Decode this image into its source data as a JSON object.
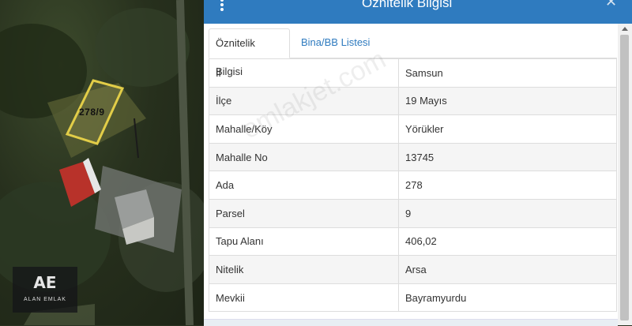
{
  "map": {
    "parcel_label": "278/9",
    "logo_mark": "AE",
    "logo_text": "ALAN EMLAK"
  },
  "modal": {
    "title": "Öznitelik Bilgisi",
    "tabs": [
      {
        "label": "Öznitelik Bilgisi",
        "active": true
      },
      {
        "label": "Bina/BB Listesi",
        "active": false
      }
    ],
    "rows": [
      {
        "key": "İl",
        "value": "Samsun"
      },
      {
        "key": "İlçe",
        "value": "19 Mayıs"
      },
      {
        "key": "Mahalle/Köy",
        "value": "Yörükler"
      },
      {
        "key": "Mahalle No",
        "value": "13745"
      },
      {
        "key": "Ada",
        "value": "278"
      },
      {
        "key": "Parsel",
        "value": "9"
      },
      {
        "key": "Tapu Alanı",
        "value": "406,02"
      },
      {
        "key": "Nitelik",
        "value": "Arsa"
      },
      {
        "key": "Mevkii",
        "value": "Bayramyurdu"
      }
    ]
  },
  "watermark": "emlakjet.com",
  "colors": {
    "header": "#2f7bbf",
    "link": "#2f7bbf"
  },
  "icons": {
    "menu": "kebab-menu-icon",
    "close": "close-icon"
  }
}
